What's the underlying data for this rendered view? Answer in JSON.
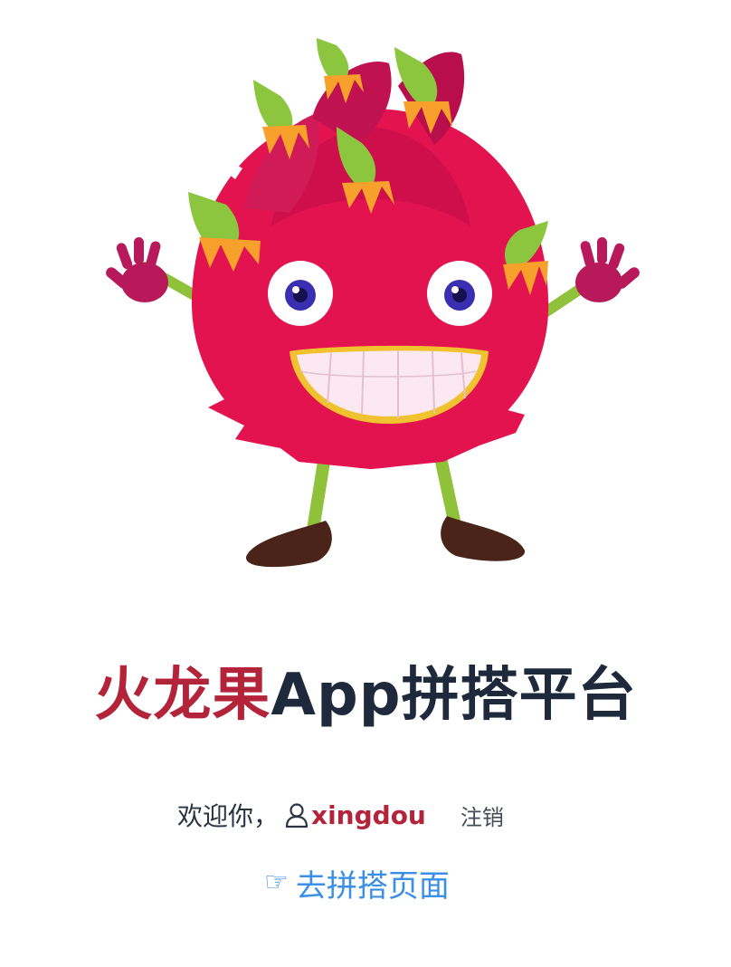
{
  "header": {
    "title_brand": "火龙果",
    "title_rest": "App拼搭平台"
  },
  "user_bar": {
    "welcome": "欢迎你，",
    "user_icon": "user-icon",
    "username": "xingdou",
    "logout_label": "注销"
  },
  "nav": {
    "hand_icon": "pointing-hand-icon",
    "goto_label": "去拼搭页面"
  },
  "colors": {
    "brand": "#b3243b",
    "text_dark": "#1e2a3b",
    "link": "#3b8fe6"
  }
}
